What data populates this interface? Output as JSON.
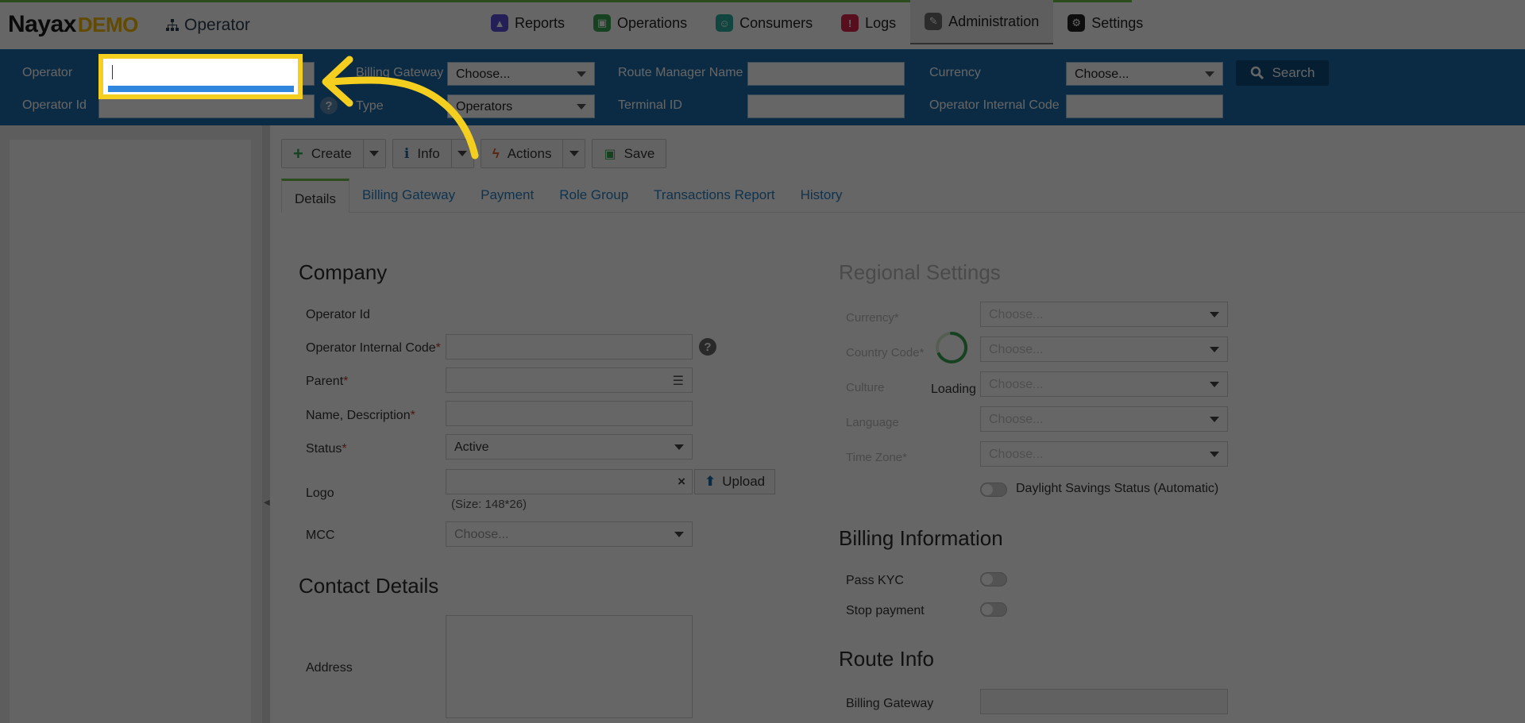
{
  "app": {
    "logo_main": "Nayax",
    "logo_accent": "DEMO",
    "section_title": "Operator"
  },
  "nav": {
    "items": [
      {
        "label": "Reports",
        "icon": "reports-icon",
        "color": "#5b4fd6"
      },
      {
        "label": "Operations",
        "icon": "operations-icon",
        "color": "#3aa655"
      },
      {
        "label": "Consumers",
        "icon": "consumers-icon",
        "color": "#2bb0a0"
      },
      {
        "label": "Logs",
        "icon": "logs-icon",
        "color": "#d9234a"
      },
      {
        "label": "Administration",
        "icon": "administration-icon",
        "color": "#6b6b6b"
      },
      {
        "label": "Settings",
        "icon": "settings-icon",
        "color": "#222222"
      }
    ],
    "active_index": 4
  },
  "filters": {
    "operator_label": "Operator",
    "operator_id_label": "Operator Id",
    "billing_gateway_label": "Billing Gateway",
    "billing_gateway_value": "Choose...",
    "type_label": "Type",
    "type_value": "Operators",
    "route_manager_label": "Route Manager Name",
    "terminal_id_label": "Terminal ID",
    "currency_label": "Currency",
    "currency_value": "Choose...",
    "internal_code_label": "Operator Internal Code",
    "search_label": "Search"
  },
  "toolbar": {
    "create": "Create",
    "info": "Info",
    "actions": "Actions",
    "save": "Save"
  },
  "tabs": [
    "Details",
    "Billing Gateway",
    "Payment",
    "Role Group",
    "Transactions Report",
    "History"
  ],
  "company": {
    "title": "Company",
    "operator_id": "Operator Id",
    "internal_code": "Operator Internal Code",
    "parent": "Parent",
    "name": "Name, Description",
    "status": "Status",
    "status_value": "Active",
    "logo": "Logo",
    "upload": "Upload",
    "logo_size": "(Size: 148*26)",
    "mcc": "MCC",
    "mcc_value": "Choose...",
    "required_mark": "*"
  },
  "contact": {
    "title": "Contact Details",
    "address": "Address"
  },
  "regional": {
    "title": "Regional Settings",
    "currency": "Currency",
    "country_code": "Country Code",
    "culture": "Culture",
    "language": "Language",
    "time_zone": "Time Zone",
    "choose": "Choose...",
    "loading": "Loading",
    "dst": "Daylight Savings Status (Automatic)"
  },
  "billing": {
    "title": "Billing Information",
    "pass_kyc": "Pass KYC",
    "stop_payment": "Stop payment"
  },
  "route": {
    "title": "Route Info",
    "billing_gateway": "Billing Gateway"
  },
  "colors": {
    "highlight": "#f5cf1f",
    "filterbar": "#1b6ca8",
    "accent_green": "#6fbf4a"
  }
}
